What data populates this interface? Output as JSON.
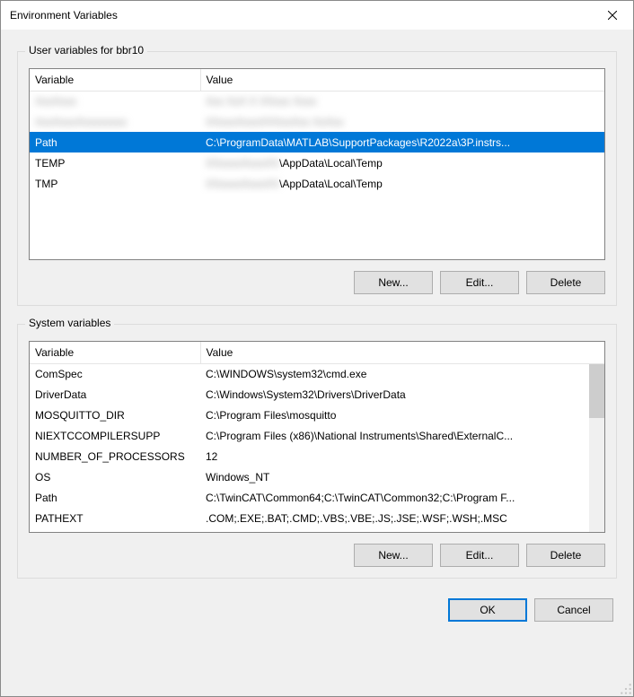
{
  "window": {
    "title": "Environment Variables"
  },
  "user_section": {
    "title": "User variables for bbr10",
    "headers": {
      "var": "Variable",
      "val": "Value"
    },
    "rows": [
      {
        "var_blur": "XxxXxxx",
        "val_blur": "Xxx XxX X XXxxx  Xxxx",
        "var": "",
        "val": ""
      },
      {
        "var_blur": "XxxXxxxXxxxxxxxx",
        "val_blur": "XXxxxXxxxXXXxxXxx  XxXxx",
        "var": "",
        "val": ""
      },
      {
        "var": "Path",
        "val": "C:\\ProgramData\\MATLAB\\SupportPackages\\R2022a\\3P.instrs...",
        "selected": true
      },
      {
        "var": "TEMP",
        "val_blur": "XXxxxxXxxxXX",
        "val_suffix": "\\AppData\\Local\\Temp"
      },
      {
        "var": "TMP",
        "val_blur": "XXxxxxXxxxXX",
        "val_suffix": "\\AppData\\Local\\Temp"
      }
    ],
    "buttons": {
      "new": "New...",
      "edit": "Edit...",
      "delete": "Delete"
    }
  },
  "system_section": {
    "title": "System variables",
    "headers": {
      "var": "Variable",
      "val": "Value"
    },
    "rows": [
      {
        "var": "ComSpec",
        "val": "C:\\WINDOWS\\system32\\cmd.exe"
      },
      {
        "var": "DriverData",
        "val": "C:\\Windows\\System32\\Drivers\\DriverData"
      },
      {
        "var": "MOSQUITTO_DIR",
        "val": "C:\\Program Files\\mosquitto"
      },
      {
        "var": "NIEXTCCOMPILERSUPP",
        "val": "C:\\Program Files (x86)\\National Instruments\\Shared\\ExternalC..."
      },
      {
        "var": "NUMBER_OF_PROCESSORS",
        "val": "12"
      },
      {
        "var": "OS",
        "val": "Windows_NT"
      },
      {
        "var": "Path",
        "val": "C:\\TwinCAT\\Common64;C:\\TwinCAT\\Common32;C:\\Program F..."
      },
      {
        "var": "PATHEXT",
        "val": ".COM;.EXE;.BAT;.CMD;.VBS;.VBE;.JS;.JSE;.WSF;.WSH;.MSC"
      }
    ],
    "buttons": {
      "new": "New...",
      "edit": "Edit...",
      "delete": "Delete"
    }
  },
  "footer": {
    "ok": "OK",
    "cancel": "Cancel"
  }
}
